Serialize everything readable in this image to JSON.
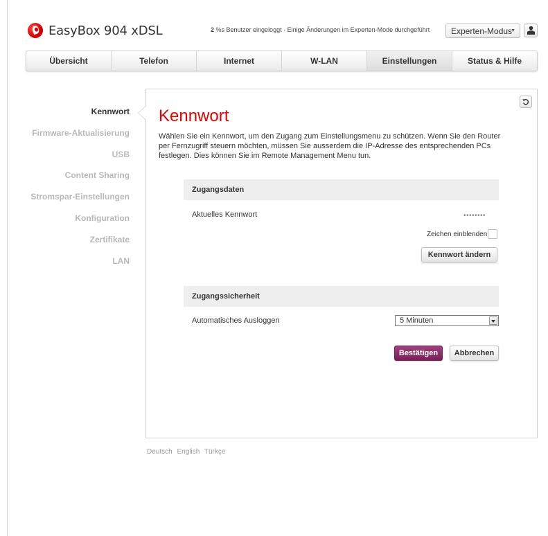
{
  "header": {
    "brand": "EasyBox 904 xDSL",
    "status_count": "2",
    "status_text": " %s Benutzer eingeloggt · Einige Änderungen im Experten-Mode durchgeführt",
    "mode_select": "Experten-Modus",
    "mode_caret_icon": "chevron-down-icon",
    "user_icon": "user-icon",
    "logo_icon": "vodafone-logo"
  },
  "tabs": [
    {
      "label": "Übersicht"
    },
    {
      "label": "Telefon"
    },
    {
      "label": "Internet"
    },
    {
      "label": "W-LAN"
    },
    {
      "label": "Einstellungen",
      "active": true
    },
    {
      "label": "Status & Hilfe"
    }
  ],
  "sidebar": {
    "items": [
      {
        "label": "Kennwort",
        "active": true
      },
      {
        "label": "Firmware-Aktualisierung"
      },
      {
        "label": "USB"
      },
      {
        "label": "Content Sharing"
      },
      {
        "label": "Stromspar-Einstellungen"
      },
      {
        "label": "Konfiguration"
      },
      {
        "label": "Zertifikate"
      },
      {
        "label": "LAN"
      }
    ]
  },
  "main": {
    "title": "Kennwort",
    "intro": "Wählen Sie ein Kennwort, um den Zugang zum Einstellungsmenu zu schützen. Wenn Sie den Router per Fernzugriff steuern möchten, müssen Sie ausserdem die IP-Adresse des entsprechenden PCs festlegen. Dies können Sie im Remote Management Menu tun.",
    "section1": {
      "heading": "Zugangsdaten",
      "current_password_label": "Aktuelles Kennwort",
      "current_password_value": "••••••••",
      "show_chars_label": "Zeichen einblenden",
      "change_button": "Kennwort ändern"
    },
    "section2": {
      "heading": "Zugangssicherheit",
      "auto_logout_label": "Automatisches Ausloggen",
      "auto_logout_value": "5 Minuten"
    },
    "confirm_button": "Bestätigen",
    "cancel_button": "Abbrechen",
    "reset_icon": "undo-icon"
  },
  "footer": {
    "languages": [
      "Deutsch",
      "English",
      "Türkçe"
    ]
  },
  "colors": {
    "accent_red": "#e60000",
    "primary_button": "#8a2a68"
  }
}
